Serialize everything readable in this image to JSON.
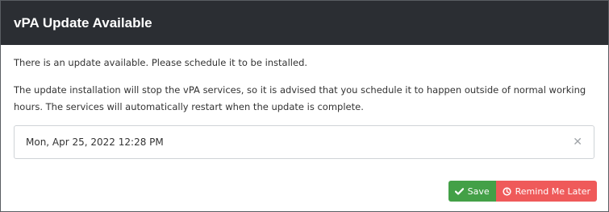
{
  "dialog": {
    "title": "vPA Update Available",
    "message_1": "There is an update available. Please schedule it to be installed.",
    "message_2": "The update installation will stop the vPA services, so it is advised that you schedule it to happen outside of normal working hours. The services will automatically restart when the update is complete.",
    "schedule_field": {
      "value": "Mon, Apr 25, 2022 12:28 PM",
      "clear_icon": "close-icon"
    },
    "buttons": {
      "save_label": "Save",
      "save_icon": "check-icon",
      "remind_label": "Remind Me Later",
      "remind_icon": "clock-icon"
    }
  },
  "colors": {
    "header_bg": "#2b2e33",
    "save_bg": "#43a047",
    "remind_bg": "#ef5a5a"
  }
}
